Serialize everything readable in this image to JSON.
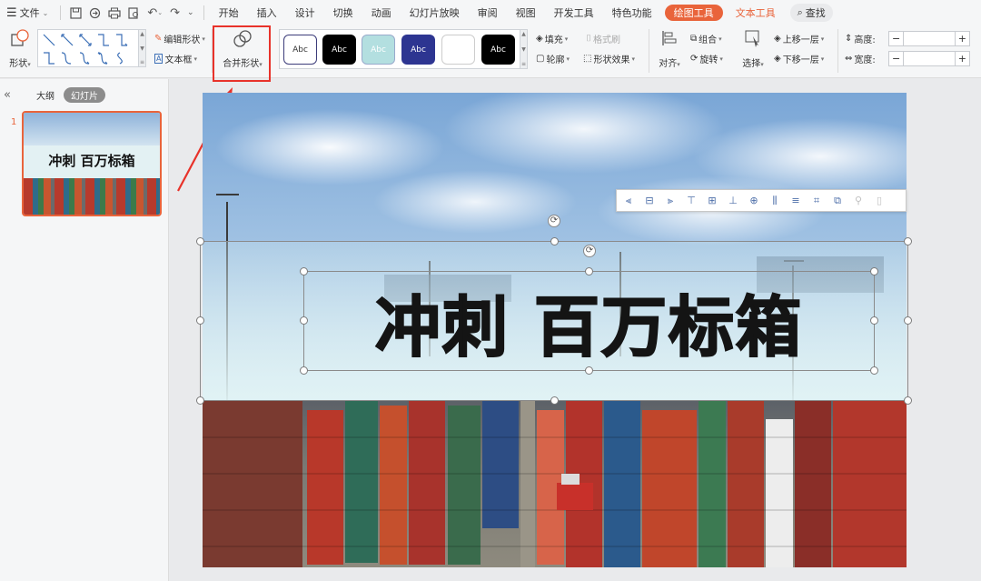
{
  "menubar": {
    "file": "文件",
    "tabs": [
      "开始",
      "插入",
      "设计",
      "切换",
      "动画",
      "幻灯片放映",
      "审阅",
      "视图",
      "开发工具",
      "特色功能"
    ],
    "drawing_tools": "绘图工具",
    "text_tools": "文本工具",
    "search": "查找"
  },
  "ribbon": {
    "shape": "形状",
    "edit_shape": "编辑形状",
    "text_box": "文本框",
    "merge_shapes": "合并形状",
    "style_label": "Abc",
    "fill": "填充",
    "format_painter": "格式刷",
    "outline": "轮廓",
    "shape_effects": "形状效果",
    "align": "对齐",
    "group": "组合",
    "rotate": "旋转",
    "select": "选择",
    "bring_forward": "上移一层",
    "send_backward": "下移一层",
    "height_label": "高度:",
    "width_label": "宽度:",
    "height_value": "",
    "width_value": ""
  },
  "panel": {
    "outline_tab": "大纲",
    "slides_tab": "幻灯片",
    "slide_number": "1"
  },
  "slide": {
    "title": "冲刺 百万标箱"
  },
  "colors": {
    "accent": "#e9643b",
    "highlight": "#e8322a",
    "link_blue": "#4c6ea8"
  }
}
